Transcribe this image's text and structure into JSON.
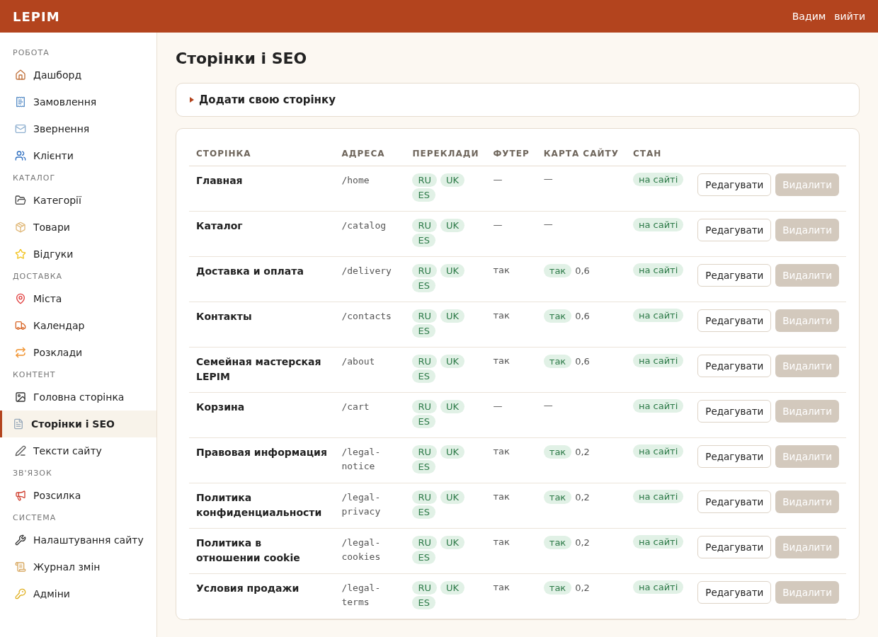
{
  "header": {
    "brand": "LEPIM",
    "user": "Вадим",
    "logout": "вийти"
  },
  "sidebar": {
    "sections": [
      {
        "title": "РОБОТА",
        "items": [
          {
            "label": "Дашборд",
            "selected": false
          },
          {
            "label": "Замовлення",
            "selected": false
          },
          {
            "label": "Звернення",
            "selected": false
          },
          {
            "label": "Клієнти",
            "selected": false
          }
        ]
      },
      {
        "title": "КАТАЛОГ",
        "items": [
          {
            "label": "Категорії",
            "selected": false
          },
          {
            "label": "Товари",
            "selected": false
          },
          {
            "label": "Відгуки",
            "selected": false
          }
        ]
      },
      {
        "title": "ДОСТАВКА",
        "items": [
          {
            "label": "Міста",
            "selected": false
          },
          {
            "label": "Календар",
            "selected": false
          },
          {
            "label": "Розклади",
            "selected": false
          }
        ]
      },
      {
        "title": "КОНТЕНТ",
        "items": [
          {
            "label": "Головна сторінка",
            "selected": false
          },
          {
            "label": "Сторінки і SEO",
            "selected": true
          },
          {
            "label": "Тексти сайту",
            "selected": false
          }
        ]
      },
      {
        "title": "ЗВ'ЯЗОК",
        "items": [
          {
            "label": "Розсилка",
            "selected": false
          }
        ]
      },
      {
        "title": "СИСТЕМА",
        "items": [
          {
            "label": "Налаштування сайту",
            "selected": false
          },
          {
            "label": "Журнал змін",
            "selected": false
          },
          {
            "label": "Адміни",
            "selected": false
          }
        ]
      }
    ]
  },
  "page": {
    "title": "Сторінки і SEO",
    "add_panel": {
      "label": "Додати свою сторінку",
      "expanded": false
    }
  },
  "table": {
    "columns": [
      "СТОРІНКА",
      "АДРЕСА",
      "ПЕРЕКЛАДИ",
      "ФУТЕР",
      "КАРТА САЙТУ",
      "СТАН"
    ],
    "rows": [
      {
        "name": "Главная",
        "address": "/home",
        "translations": [
          "RU",
          "UK",
          "ES"
        ],
        "footer": "—",
        "sitemap": "—",
        "status": "на сайті",
        "edit": "Редагувати",
        "delete": "Видалити"
      },
      {
        "name": "Каталог",
        "address": "/catalog",
        "translations": [
          "RU",
          "UK",
          "ES"
        ],
        "footer": "—",
        "sitemap": "—",
        "status": "на сайті",
        "edit": "Редагувати",
        "delete": "Видалити"
      },
      {
        "name": "Доставка и оплата",
        "address": "/delivery",
        "translations": [
          "RU",
          "UK",
          "ES"
        ],
        "footer": "так",
        "sitemap": "так",
        "priority": "0,6",
        "status": "на сайті",
        "edit": "Редагувати",
        "delete": "Видалити"
      },
      {
        "name": "Контакты",
        "address": "/contacts",
        "translations": [
          "RU",
          "UK",
          "ES"
        ],
        "footer": "так",
        "sitemap": "так",
        "priority": "0,6",
        "status": "на сайті",
        "edit": "Редагувати",
        "delete": "Видалити"
      },
      {
        "name": "Семейная мастерская LEPIM",
        "address": "/about",
        "translations": [
          "RU",
          "UK",
          "ES"
        ],
        "footer": "так",
        "sitemap": "так",
        "priority": "0,6",
        "status": "на сайті",
        "edit": "Редагувати",
        "delete": "Видалити"
      },
      {
        "name": "Корзина",
        "address": "/cart",
        "translations": [
          "RU",
          "UK",
          "ES"
        ],
        "footer": "—",
        "sitemap": "—",
        "status": "на сайті",
        "edit": "Редагувати",
        "delete": "Видалити"
      },
      {
        "name": "Правовая информация",
        "address": "/legal-notice",
        "translations": [
          "RU",
          "UK",
          "ES"
        ],
        "footer": "так",
        "sitemap": "так",
        "priority": "0,2",
        "status": "на сайті",
        "edit": "Редагувати",
        "delete": "Видалити"
      },
      {
        "name": "Политика конфиденциальности",
        "address": "/legal-privacy",
        "translations": [
          "RU",
          "UK",
          "ES"
        ],
        "footer": "так",
        "sitemap": "так",
        "priority": "0,2",
        "status": "на сайті",
        "edit": "Редагувати",
        "delete": "Видалити"
      },
      {
        "name": "Политика в отношении cookie",
        "address": "/legal-cookies",
        "translations": [
          "RU",
          "UK",
          "ES"
        ],
        "footer": "так",
        "sitemap": "так",
        "priority": "0,2",
        "status": "на сайті",
        "edit": "Редагувати",
        "delete": "Видалити"
      },
      {
        "name": "Условия продажи",
        "address": "/legal-terms",
        "translations": [
          "RU",
          "UK",
          "ES"
        ],
        "footer": "так",
        "sitemap": "так",
        "priority": "0,2",
        "status": "на сайті",
        "edit": "Редагувати",
        "delete": "Видалити"
      }
    ]
  }
}
